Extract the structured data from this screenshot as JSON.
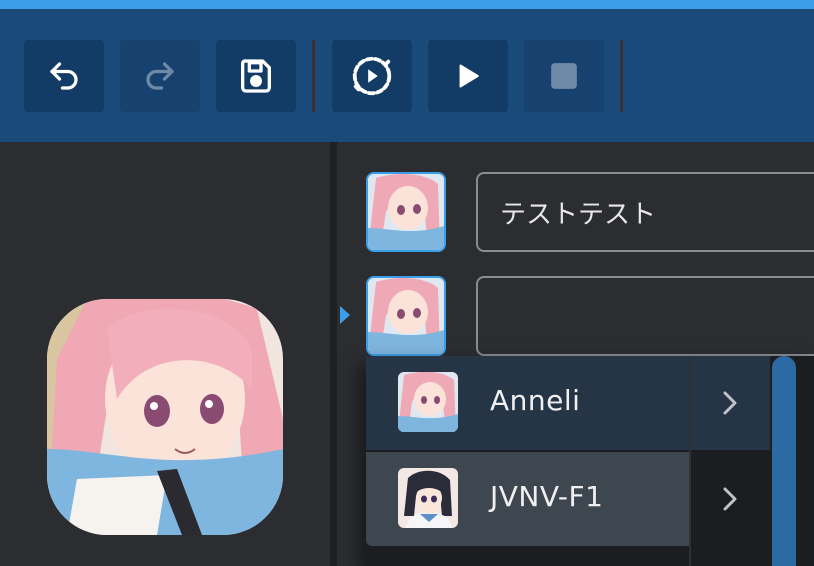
{
  "toolbar": {
    "buttons": [
      {
        "name": "undo",
        "enabled": true
      },
      {
        "name": "redo",
        "enabled": false
      },
      {
        "name": "save",
        "enabled": true
      },
      {
        "name": "replay",
        "enabled": true
      },
      {
        "name": "play",
        "enabled": true
      },
      {
        "name": "stop",
        "enabled": false
      }
    ]
  },
  "rows": [
    {
      "text": "テストテスト",
      "character": "Anneli"
    },
    {
      "text": "",
      "character": "Anneli"
    }
  ],
  "character_dropdown": {
    "items": [
      {
        "label": "Anneli",
        "state": "selected"
      },
      {
        "label": "JVNV-F1",
        "state": "hovered"
      }
    ]
  },
  "colors": {
    "accent": "#3b9ee8",
    "toolbar_bg": "#1a4a7a",
    "button_bg": "#123c66",
    "panel_bg": "#2b2d31"
  }
}
